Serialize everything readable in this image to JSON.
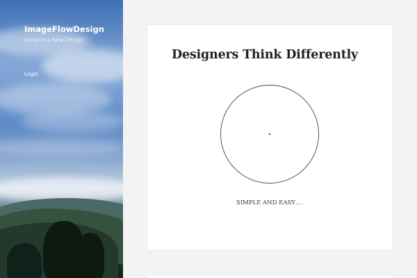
{
  "site": {
    "title": "ImageFlowDesign",
    "tagline": "Imagine a New Design"
  },
  "sidebar": {
    "nav": {
      "login_label": "Login"
    }
  },
  "post": {
    "title": "Designers Think Differently",
    "caption": "SIMPLE AND EASY…."
  },
  "colors": {
    "page_background": "#f3f3f3",
    "card_background": "#ffffff",
    "title_text": "#222222",
    "sidebar_text": "#ffffff"
  }
}
